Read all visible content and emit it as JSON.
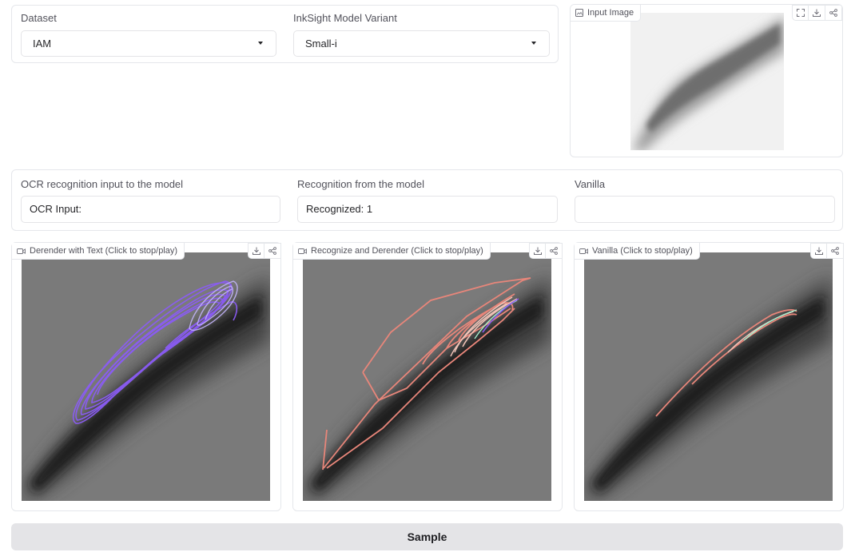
{
  "controls": {
    "dataset_label": "Dataset",
    "dataset_value": "IAM",
    "variant_label": "InkSight Model Variant",
    "variant_value": "Small-i"
  },
  "input_image": {
    "label": "Input Image",
    "icons": [
      "fullscreen-icon",
      "download-icon",
      "share-icon"
    ]
  },
  "textboxes": {
    "ocr_label": "OCR recognition input to the model",
    "ocr_value": "OCR Input:",
    "recog_label": "Recognition from the model",
    "recog_value": "Recognized: 1",
    "vanilla_label": "Vanilla",
    "vanilla_value": ""
  },
  "videos": [
    {
      "label": "Derender with Text (Click to stop/play)",
      "stroke_color": "#8b5cf6"
    },
    {
      "label": "Recognize and Derender (Click to stop/play)",
      "stroke_color": "#e8867a"
    },
    {
      "label": "Vanilla (Click to stop/play)",
      "stroke_color": "#e8867a"
    }
  ],
  "sample_button": "Sample"
}
